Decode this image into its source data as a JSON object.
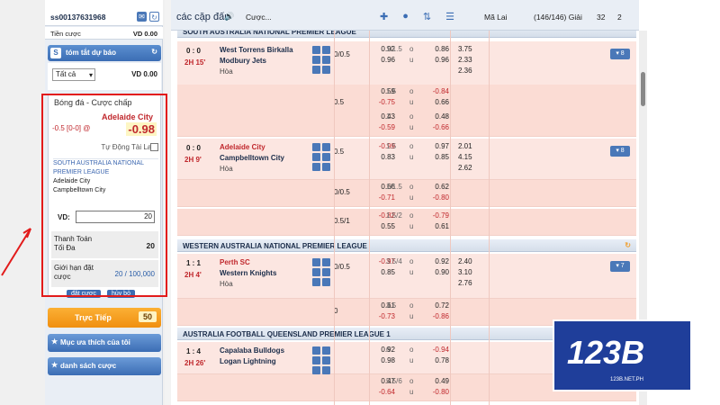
{
  "account": {
    "id": "ss00137631968",
    "credit_label": "Tiền cược",
    "credit_value": "VD 0.00"
  },
  "summary": {
    "title": "tóm tắt dự báo",
    "filter": "Tất cả",
    "value": "VD 0.00"
  },
  "betslip": {
    "title": "Bóng đá - Cược chấp",
    "team": "Adelaide City",
    "line": "-0.5 [0-0] @",
    "odds": "-0.98",
    "auto_accept": "Tự Động Tài Lai",
    "league": "SOUTH AUSTRALIA NATIONAL PREMIER LEAGUE",
    "home": "Adelaide City",
    "away": "Campbelltown City",
    "stake_label": "VD:",
    "stake_value": "20",
    "max_label": "Thanh Toán Tối Đa",
    "max_value": "20",
    "limit_label": "Giới hạn đặt cược",
    "limit_value": "20 / 100,000",
    "place": "đặt cược",
    "cancel": "hủy bỏ"
  },
  "live": {
    "label": "Trực Tiếp",
    "count": "50"
  },
  "favorites": {
    "label": "Mục ưa thích của tôi"
  },
  "bet_list": {
    "label": "danh sách cược"
  },
  "header": {
    "title": "các cặp đấu",
    "bets": "Cược...",
    "odds_type": "Mã Lai",
    "count": "(146/146) Giải",
    "g32": "32",
    "g2": "2"
  },
  "leagues": [
    "SOUTH AUSTRALIA NATIONAL PREMIER LEAGUE",
    "WESTERN AUSTRALIA NATIONAL PREMIER LEAGUE",
    "AUSTRALIA FOOTBALL QUEENSLAND PREMIER LEAGUE 1"
  ],
  "matches": [
    {
      "score": "0 : 0",
      "time": "2H 15'",
      "home": "West Torrens Birkalla",
      "away": "Modbury Jets",
      "draw": "Hòa",
      "more": "▾ 8"
    },
    {
      "score": "0 : 0",
      "time": "2H 9'",
      "home": "Adelaide City",
      "away": "Campbelltown City",
      "draw": "Hòa",
      "more": "▾ 8"
    },
    {
      "score": "1 : 1",
      "time": "2H 4'",
      "home": "Perth SC",
      "away": "Western Knights",
      "draw": "Hòa",
      "more": "▾ 7"
    },
    {
      "score": "1 : 4",
      "time": "2H 26'",
      "home": "Capalaba Bulldogs",
      "away": "Logan Lightning",
      "draw": "",
      "more": ""
    }
  ],
  "rows": [
    {
      "h": "0/0.5",
      "a": "0.92",
      "al": "1/1.5",
      "b": "0.86",
      "x": "3.75",
      "a2": "0.96",
      "b2": "0.96",
      "x2": "2.33",
      "x3": "2.36"
    },
    {
      "h": "",
      "a": "0.59",
      "al": "1.5",
      "b": "-0.84",
      "a2": "-0.75",
      "hb": "0.5",
      "b2": "0.66"
    },
    {
      "h": "",
      "a": "0.43",
      "al": "1",
      "b": "0.48",
      "a2": "-0.59",
      "b2": "-0.66"
    },
    {
      "h": "0.5",
      "a": "-0.99",
      "al": "1.5",
      "b": "0.97",
      "x": "2.01",
      "a2": "0.83",
      "b2": "0.85",
      "x2": "4.15",
      "x3": "2.62"
    },
    {
      "h": "0/0.5",
      "a": "0.66",
      "al": "1/1.5",
      "b": "0.62",
      "a2": "-0.71",
      "b2": "-0.80"
    },
    {
      "h": "0.5/1",
      "a": "-0.82",
      "al": "1.5/2",
      "b": "-0.79",
      "a2": "0.55",
      "b2": "0.61"
    },
    {
      "h": "0/0.5",
      "a": "-0.97",
      "al": "3.5/4",
      "b": "0.92",
      "x": "2.40",
      "a2": "0.85",
      "b2": "0.90",
      "x2": "3.10",
      "x3": "2.76"
    },
    {
      "h": "0",
      "a": "0.61",
      "al": "3.5",
      "b": "0.72",
      "a2": "-0.73",
      "b2": "-0.86"
    },
    {
      "h": "",
      "a": "0.92",
      "al": "6",
      "b": "-0.94",
      "a2": "0.98",
      "b2": "0.78"
    },
    {
      "h": "",
      "a": "0.47",
      "al": "5.5/6",
      "b": "0.49",
      "a2": "-0.64",
      "b2": "-0.80"
    }
  ],
  "logo": {
    "text": "123B",
    "sub": "123B.NET.PH"
  }
}
